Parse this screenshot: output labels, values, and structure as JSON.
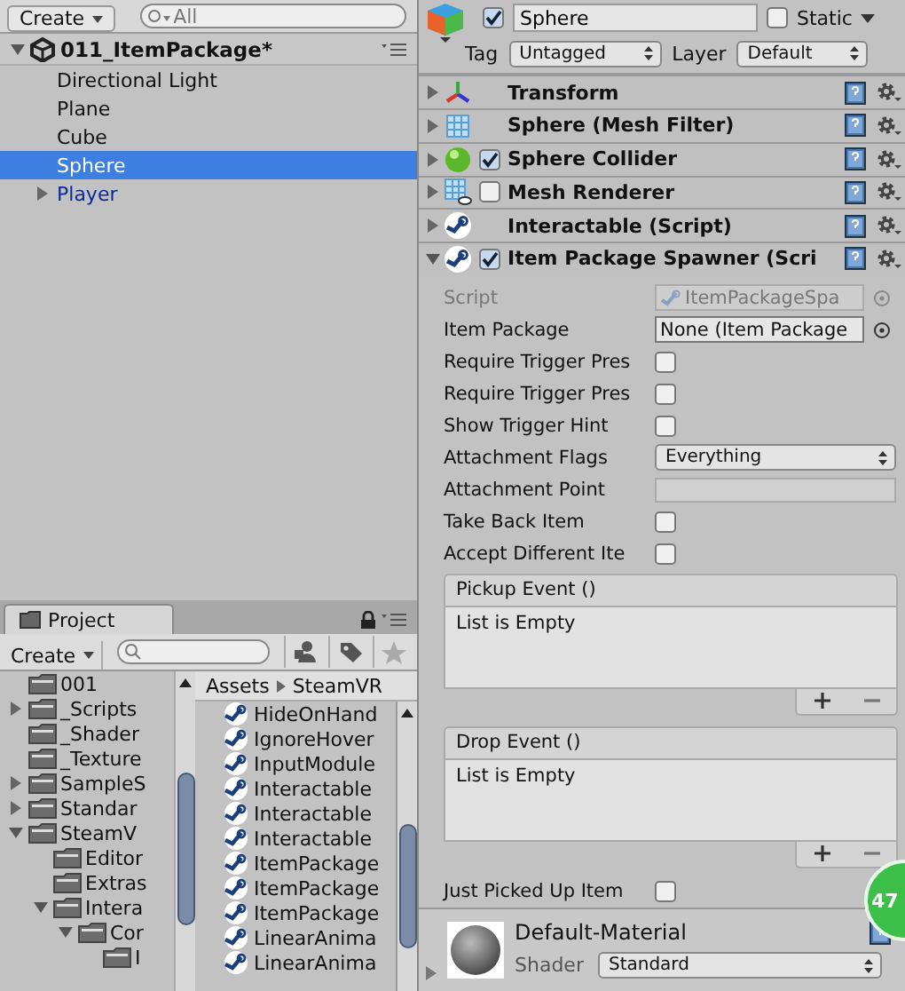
{
  "hierarchy": {
    "create_button": "Create",
    "search": {
      "placeholder": "All"
    },
    "scene": {
      "title": "011_ItemPackage*",
      "expanded": true
    },
    "items": [
      {
        "name": "Directional Light",
        "kind": "object",
        "selected": false
      },
      {
        "name": "Plane",
        "kind": "object",
        "selected": false
      },
      {
        "name": "Cube",
        "kind": "object",
        "selected": false
      },
      {
        "name": "Sphere",
        "kind": "object",
        "selected": true
      },
      {
        "name": "Player",
        "kind": "prefab",
        "selected": false,
        "expanded": false
      }
    ]
  },
  "project": {
    "tab": "Project",
    "create_button": "Create",
    "breadcrumb": [
      "Assets",
      "SteamVR"
    ],
    "folders": [
      {
        "name": "001"
      },
      {
        "name": "_Scripts",
        "expanded": false
      },
      {
        "name": "_Shader"
      },
      {
        "name": "_Texture"
      },
      {
        "name": "SampleS",
        "expanded": false
      },
      {
        "name": "Standar",
        "expanded": false
      },
      {
        "name": "SteamV",
        "expanded": true,
        "children": [
          {
            "name": "Editor"
          },
          {
            "name": "Extras"
          },
          {
            "name": "Intera",
            "expanded": true,
            "children": [
              {
                "name": "Cor",
                "expanded": true,
                "children": [
                  {
                    "name": "I"
                  }
                ]
              }
            ]
          }
        ]
      }
    ],
    "assets": [
      "HideOnHand",
      "IgnoreHover",
      "InputModule",
      "Interactable",
      "Interactable",
      "Interactable",
      "ItemPackage",
      "ItemPackage",
      "ItemPackage",
      "LinearAnima",
      "LinearAnima"
    ]
  },
  "inspector": {
    "active": true,
    "name": "Sphere",
    "static": false,
    "static_label": "Static",
    "tag_label": "Tag",
    "tag": "Untagged",
    "layer_label": "Layer",
    "layer": "Default",
    "components": [
      {
        "name": "Transform",
        "kind": "transform",
        "expanded": false
      },
      {
        "name": "Sphere (Mesh Filter)",
        "kind": "mesh-filter",
        "expanded": false
      },
      {
        "name": "Sphere Collider",
        "kind": "collider",
        "expanded": false,
        "enabled": true
      },
      {
        "name": "Mesh Renderer",
        "kind": "renderer",
        "expanded": false,
        "enabled": false
      },
      {
        "name": "Interactable (Script)",
        "kind": "script",
        "expanded": false
      },
      {
        "name": "Item Package Spawner (Scri",
        "kind": "script",
        "expanded": true,
        "enabled": true
      }
    ],
    "properties": [
      {
        "kind": "object",
        "label": "Script",
        "value": "ItemPackageSpa",
        "disabled": true
      },
      {
        "kind": "object",
        "label": "Item Package",
        "value": "None (Item Package",
        "disabled": false
      },
      {
        "kind": "toggle",
        "label": "Require Trigger Pres",
        "checked": false
      },
      {
        "kind": "toggle",
        "label": "Require Trigger Pres",
        "checked": false
      },
      {
        "kind": "toggle",
        "label": "Show Trigger Hint",
        "checked": false
      },
      {
        "kind": "dropdown",
        "label": "Attachment Flags",
        "value": "Everything"
      },
      {
        "kind": "field",
        "label": "Attachment Point"
      },
      {
        "kind": "toggle",
        "label": "Take Back Item",
        "checked": false
      },
      {
        "kind": "toggle",
        "label": "Accept Different Ite",
        "checked": false
      },
      {
        "kind": "event",
        "label": "Pickup Event ()",
        "text": "List is Empty"
      },
      {
        "kind": "event",
        "label": "Drop Event ()",
        "text": "List is Empty"
      },
      {
        "kind": "toggle",
        "label": "Just Picked Up Item",
        "checked": false
      }
    ],
    "material": {
      "name": "Default-Material",
      "shader_label": "Shader",
      "shader": "Standard"
    }
  },
  "overlay_badge": "47"
}
